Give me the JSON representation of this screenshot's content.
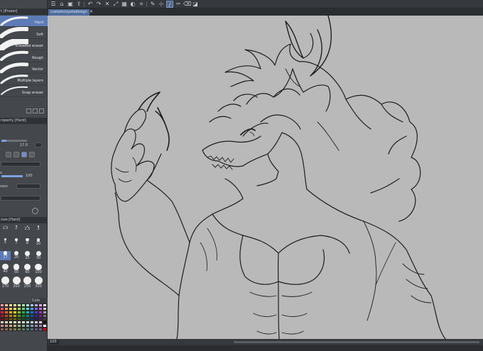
{
  "subtool_panel": {
    "tab_label": "t [Eraser]",
    "brushes": [
      {
        "label": "Hard",
        "selected": true
      },
      {
        "label": "Soft",
        "selected": false
      },
      {
        "label": "Kneaded eraser",
        "selected": false
      },
      {
        "label": "Rough",
        "selected": false
      },
      {
        "label": "Vector",
        "selected": false
      },
      {
        "label": "Multiple layers",
        "selected": false
      },
      {
        "label": "Snap eraser",
        "selected": false
      }
    ]
  },
  "tool_property": {
    "tab_label": "roperty [Hard]",
    "size_value": "17.0",
    "opacity_value": "100",
    "opacity_level": 1.0,
    "size_level": 0.2,
    "label_v": "v",
    "label_rasn": "rasn"
  },
  "brush_size_panel": {
    "tab_label": "size [Hard]",
    "sizes": [
      "1.5",
      "2",
      "2.5",
      "3",
      "5",
      "7",
      "8",
      "10",
      "17",
      "20",
      "25",
      "30",
      "40",
      "50",
      "60",
      "100",
      "170",
      "200",
      "250",
      "300"
    ]
  },
  "color_panel": {
    "tab_label": "Colo",
    "swatches": [
      "#ff9fb0",
      "#ffc8a0",
      "#ffe79a",
      "#fff9a8",
      "#d6f5a0",
      "#a8f0b8",
      "#a8eef0",
      "#a6c9f5",
      "#b8b0f3",
      "#e2b0f0",
      "#ffffff",
      "#ff5470",
      "#ff9a55",
      "#ffd445",
      "#fff35a",
      "#a8e85c",
      "#55df7c",
      "#4fdcdf",
      "#5699ee",
      "#7b6be8",
      "#cc63e6",
      "#d0d0d0",
      "#e0203d",
      "#ef6c1a",
      "#f1b300",
      "#e9df00",
      "#6fcf1f",
      "#18b84a",
      "#12b4b8",
      "#1e6ed8",
      "#4f35cf",
      "#a52fcb",
      "#a0a0a0",
      "#a81330",
      "#b84a0e",
      "#b88500",
      "#aca300",
      "#4b9a13",
      "#0e8434",
      "#0b8386",
      "#144fa2",
      "#35219a",
      "#781e96",
      "#707070",
      "#6e0c1f",
      "#7a3008",
      "#7a5800",
      "#716b00",
      "#30650b",
      "#085622",
      "#075557",
      "#0c336a",
      "#221365",
      "#4f1262",
      "#404040",
      "#f3c1c6",
      "#f4d6c1",
      "#f5e8c0",
      "#f2f1c3",
      "#dcefc3",
      "#c6ecd0",
      "#c4ebec",
      "#c3d6ef",
      "#cfc9ef",
      "#e6c8ee",
      "#101010",
      "#c78a8f",
      "#c59b83",
      "#c4b07f",
      "#bfb97f",
      "#9fb983",
      "#85b393",
      "#82b1b3",
      "#839ebf",
      "#918ab9",
      "#a887b6",
      "#ffffff",
      "#8f5a5e",
      "#8a6551",
      "#877550",
      "#827c50",
      "#687e52",
      "#557b61",
      "#537879",
      "#536c87",
      "#5f5a82",
      "#735a80",
      "#ff0000"
    ]
  },
  "toolbar": {
    "buttons": [
      "menu-icon",
      "home-icon",
      "save-icon",
      "export-icon",
      "undo-icon",
      "redo-icon",
      "clear-icon",
      "transform-icon",
      "fill-icon",
      "invert-icon",
      "crop-icon",
      "brush-icon",
      "snap-icon",
      "ruler-icon",
      "pen-icon",
      "eraser-icon",
      "fill-bucket-icon"
    ],
    "active_index": 13
  },
  "document": {
    "tab_label": "customcoyotedesign",
    "close_glyph": "×"
  },
  "status_bar": {
    "zoom": "100"
  }
}
